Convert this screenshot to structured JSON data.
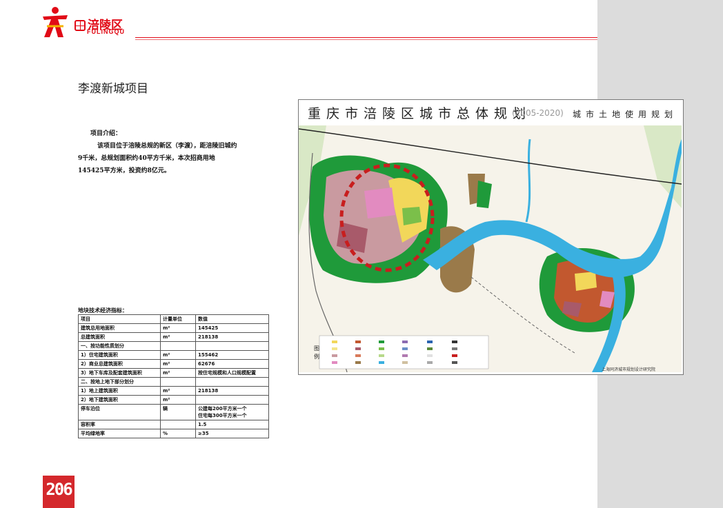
{
  "header": {
    "logo_name": "涪陵区",
    "logo_en": "FULINGQU"
  },
  "page": {
    "title": "李渡新城项目",
    "number": "206"
  },
  "intro": {
    "heading": "项目介绍：",
    "body": "该项目位于涪陵总规的新区（李渡），距涪陵旧城约9千米，总规划面积约40平方千米，本次招商用地145425平方米，投资约8亿元。"
  },
  "spec_table": {
    "title": "地块技术经济指标：",
    "header": [
      "项目",
      "计量单位",
      "数值"
    ],
    "rows": [
      [
        "建筑总用地面积",
        "m²",
        "145425"
      ],
      [
        "总建筑面积",
        "m²",
        "218138"
      ],
      [
        "一、按功能性质划分",
        "",
        ""
      ],
      [
        "1）住宅建筑面积",
        "m²",
        "155462"
      ],
      [
        "2）商业总建筑面积",
        "m²",
        "62676"
      ],
      [
        "3）地下车库及配套建筑面积",
        "m²",
        "按住宅规模和人口规模配置"
      ],
      [
        "二、按地上地下部分划分",
        "",
        ""
      ],
      [
        "1）地上建筑面积",
        "m²",
        "218138"
      ],
      [
        "2）地下建筑面积",
        "m²",
        ""
      ],
      [
        "停车泊位",
        "辆",
        "公建每200平方米一个\n住宅每300平方米一个"
      ],
      [
        "容积率",
        "",
        "1.5"
      ],
      [
        "平均绿地率",
        "%",
        "≥35"
      ]
    ]
  },
  "map": {
    "title": "重庆市涪陵区城市总体规划",
    "year": "(2005-2020)",
    "subtitle": "城市土地使用规划",
    "legend_label": "图例",
    "credit": "上海同济城市规划设计研究院"
  },
  "colors": {
    "brand_red": "#e10b17",
    "page_num_bg": "#d4282c",
    "river": "#3ab0e0",
    "green": "#1f9a3a",
    "highlight_ring": "#c81e1e"
  }
}
